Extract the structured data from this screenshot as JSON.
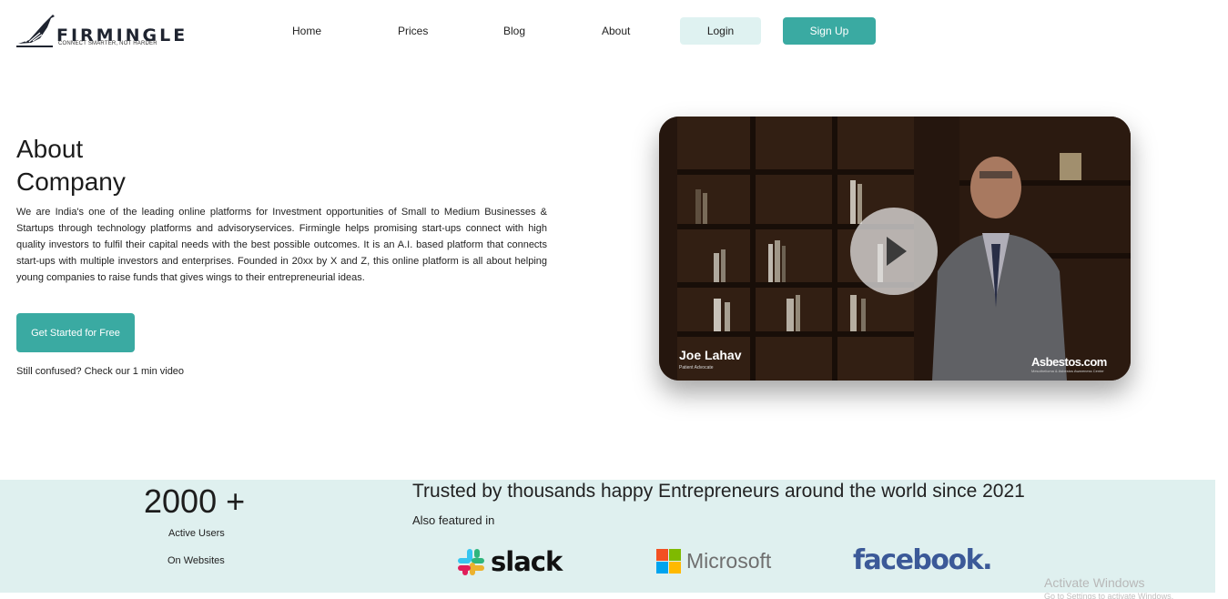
{
  "brand": {
    "name": "FIRMINGLE",
    "tagline": "CONNECT SMARTER, NOT HARDER"
  },
  "nav": {
    "links": [
      "Home",
      "Prices",
      "Blog",
      "About"
    ],
    "login": "Login",
    "signup": "Sign Up"
  },
  "about": {
    "title_line1": "About",
    "title_line2": "Company",
    "body": "We are India's one of the leading online platforms for Investment opportunities of Small to Medium Businesses & Startups through technology platforms and advisoryservices. Firmingle helps promising start-ups connect with high quality investors to fulfil their capital needs with the best possible outcomes. It is an A.I. based platform that connects start-ups with multiple investors and enterprises. Founded in 20xx by X and Z, this online platform is all about helping young companies to raise funds that gives wings to their entrepreneurial ideas.",
    "cta": "Get Started for Free",
    "confused": "Still confused? Check our 1 min video"
  },
  "video": {
    "person_name": "Joe Lahav",
    "person_title": "Patient Advocate",
    "brand": "Asbestos.com",
    "brand_sub": "Mesothelioma & Asbestos Awareness Center",
    "icon": "play-icon"
  },
  "stats": {
    "count": "2000 +",
    "line1": "Active Users",
    "line2": "On Websites"
  },
  "trust": {
    "headline": "Trusted by thousands happy Entrepreneurs around the world since 2021",
    "featured": "Also featured in",
    "logos": {
      "slack": "slack",
      "microsoft": "Microsoft",
      "facebook": "facebook."
    }
  },
  "colors": {
    "accent": "#3aaaa2",
    "accent_light": "#dff2f1",
    "band": "#dff0ef",
    "facebook": "#3b5998"
  },
  "watermark": {
    "title": "Activate Windows",
    "sub": "Go to Settings to activate Windows."
  }
}
